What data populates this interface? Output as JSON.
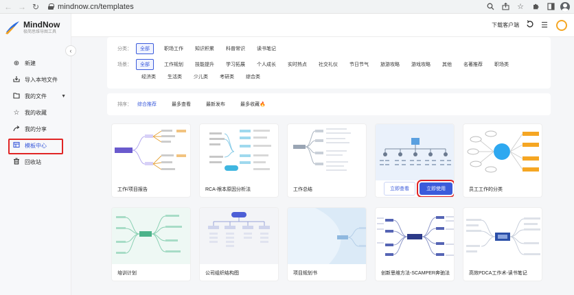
{
  "browser": {
    "url": "mindnow.cn/templates"
  },
  "brand": {
    "name": "MindNow",
    "tagline": "极简思维导图工具",
    "accent": "#3b5bdb",
    "alert": "#e02424"
  },
  "sidebar": {
    "items": [
      {
        "label": "新建",
        "icon": "plus-circle-icon"
      },
      {
        "label": "导入本地文件",
        "icon": "import-icon"
      },
      {
        "label": "我的文件",
        "icon": "folder-icon"
      },
      {
        "label": "我的收藏",
        "icon": "star-icon"
      },
      {
        "label": "我的分享",
        "icon": "share-icon"
      },
      {
        "label": "模板中心",
        "icon": "template-icon"
      },
      {
        "label": "回收站",
        "icon": "trash-icon"
      }
    ]
  },
  "header": {
    "download": "下载客户端"
  },
  "filters": {
    "category_label": "分类：",
    "categories": [
      "全部",
      "职场工作",
      "知识积累",
      "科普常识",
      "读书笔记"
    ],
    "scene_label": "场景：",
    "scenes_row1": [
      "全部",
      "工作规划",
      "技能提升",
      "学习拓展",
      "个人成长",
      "实时热点",
      "社交礼仪",
      "节日节气",
      "旅游攻略",
      "游戏攻略",
      "其他",
      "名著推荐",
      "职场类"
    ],
    "scenes_row2": [
      "经济类",
      "生活类",
      "少儿类",
      "考研类",
      "综合类"
    ]
  },
  "sort": {
    "label": "排序：",
    "options": [
      "综合推荐",
      "最多查看",
      "最新发布",
      "最多收藏"
    ]
  },
  "templates": [
    {
      "name": "工作/项目报告"
    },
    {
      "name": "RCA-根本原因分析法"
    },
    {
      "name": "工作总结"
    },
    {
      "name": ""
    },
    {
      "name": "员工工作的分类"
    },
    {
      "name": "培训计划"
    },
    {
      "name": "公司组织结构图"
    },
    {
      "name": "项目规划书"
    },
    {
      "name": "创新思维方法-SCAMPER奔驰法"
    },
    {
      "name": "高效PDCA工作术-读书笔记"
    }
  ],
  "hover_card": {
    "preview": "立即查看",
    "use": "立即使用"
  }
}
